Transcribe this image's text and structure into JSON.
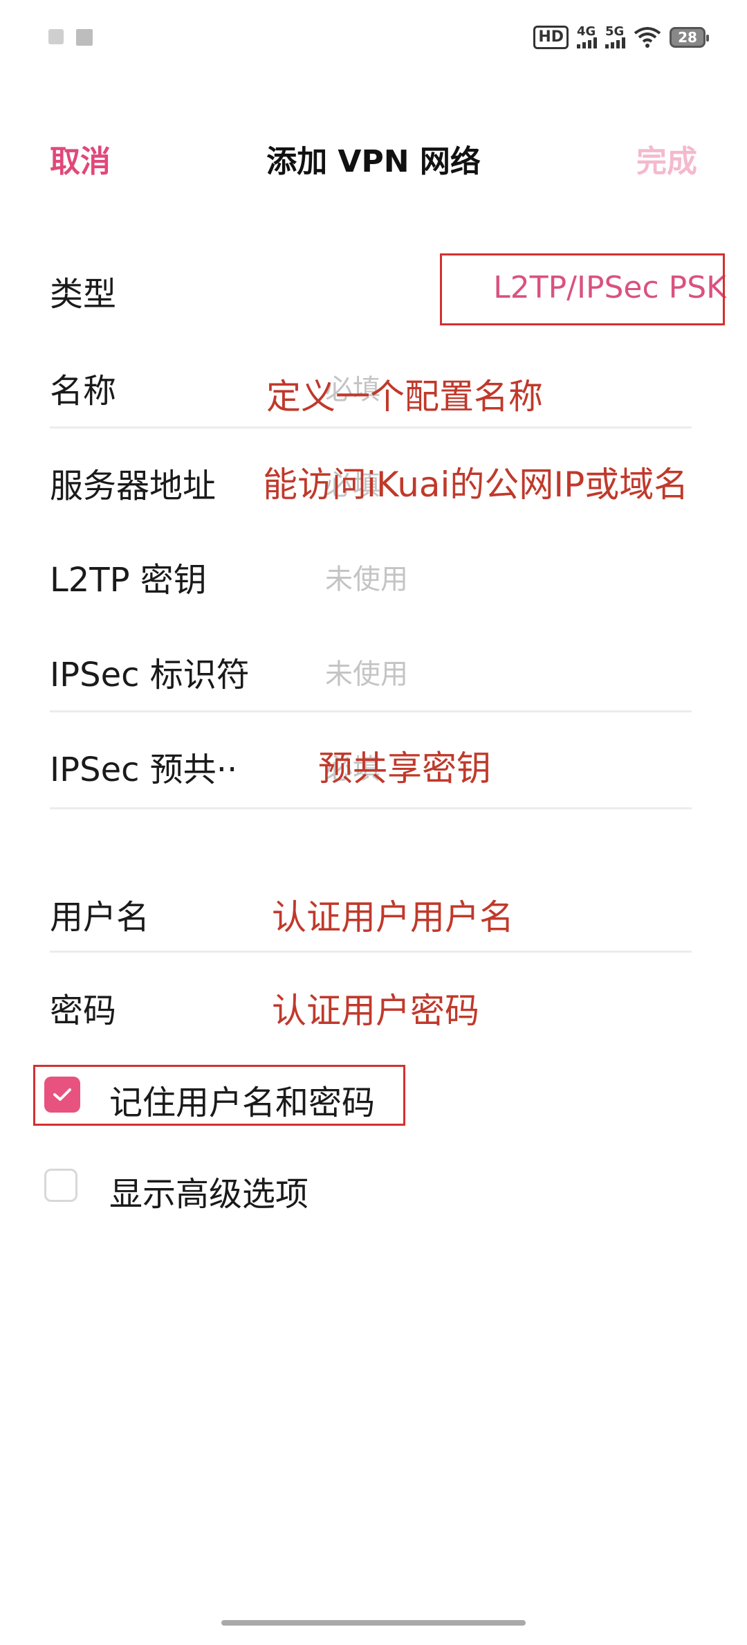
{
  "status_bar": {
    "hd": "HD",
    "net1": "4G",
    "net2": "5G",
    "battery": "28"
  },
  "header": {
    "cancel": "取消",
    "title": "添加 VPN 网络",
    "done": "完成"
  },
  "form": {
    "type_label": "类型",
    "type_value": "L2TP/IPSec PSK",
    "name_label": "名称",
    "name_placeholder": "必填",
    "server_label": "服务器地址",
    "server_placeholder": "必填",
    "l2tp_label": "L2TP 密钥",
    "l2tp_placeholder": "未使用",
    "ipsec_id_label": "IPSec 标识符",
    "ipsec_id_placeholder": "未使用",
    "ipsec_psk_label": "IPSec 预共··",
    "ipsec_psk_placeholder": "必填",
    "username_label": "用户名",
    "password_label": "密码"
  },
  "annotations": {
    "name": "定义一个配置名称",
    "server": "能访问iKuai的公网IP或域名",
    "psk": "预共享密钥",
    "username": "认证用户用户名",
    "password": "认证用户密码"
  },
  "options": {
    "remember": {
      "label": "记住用户名和密码",
      "checked": true
    },
    "advanced": {
      "label": "显示高级选项",
      "checked": false
    }
  },
  "colors": {
    "accent": "#e0487a",
    "annotation": "#c0392b"
  }
}
